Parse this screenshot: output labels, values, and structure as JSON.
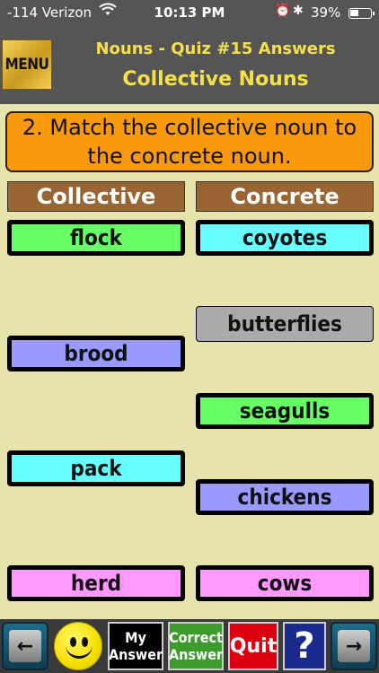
{
  "status_bar": {
    "carrier": "-114 Verizon",
    "time": "10:13 PM",
    "battery": "39%",
    "battery_level": 0.39
  },
  "header": {
    "menu_label": "MENU",
    "quiz_title": "Nouns - Quiz #15 Answers",
    "topic_title": "Collective Nouns"
  },
  "question": "2. Match the collective noun to the concrete noun.",
  "columns": {
    "left": "Collective",
    "right": "Concrete"
  },
  "collective": [
    {
      "label": "flock",
      "color": "#66ff66"
    },
    {
      "label": "brood",
      "color": "#9999ff"
    },
    {
      "label": "pack",
      "color": "#66ffff"
    },
    {
      "label": "herd",
      "color": "#ff99ff"
    }
  ],
  "concrete": [
    {
      "label": "coyotes",
      "color": "#66ffff"
    },
    {
      "label": "butterflies",
      "color": "#aaaaaa"
    },
    {
      "label": "seagulls",
      "color": "#66ff66"
    },
    {
      "label": "chickens",
      "color": "#9999ff"
    },
    {
      "label": "cows",
      "color": "#ff99ff"
    }
  ],
  "toolbar": {
    "back_symbol": "←",
    "my_answer_line1": "My",
    "my_answer_line2": "Answer",
    "correct_answer_line1": "Correct",
    "correct_answer_line2": "Answer",
    "quit": "Quit",
    "help": "?",
    "forward_symbol": "→"
  },
  "icons": {
    "wifi": "wifi-icon",
    "alarm": "alarm-icon",
    "bluetooth": "bluetooth-icon",
    "battery": "battery-icon",
    "smiley": "smiley-icon"
  }
}
